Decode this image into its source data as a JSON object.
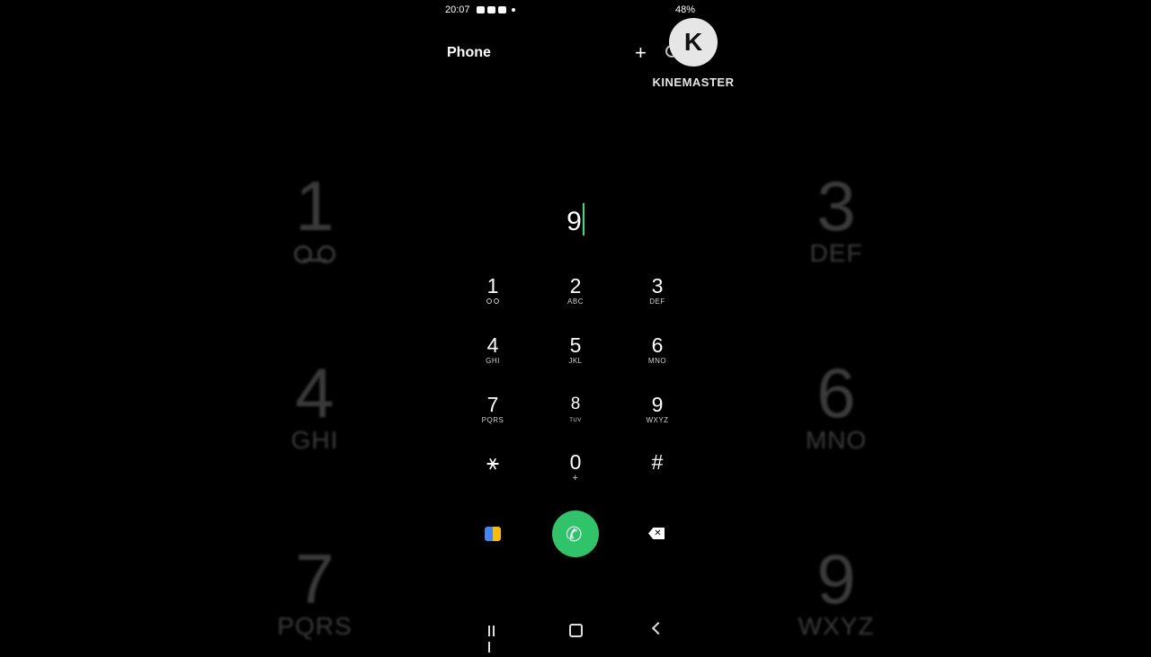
{
  "status": {
    "time": "20:07",
    "battery": "48%"
  },
  "header": {
    "title": "Phone",
    "add_icon": "plus-icon",
    "search_icon": "search-icon"
  },
  "watermark": {
    "letter": "K",
    "text": "KINEMASTER"
  },
  "dialer": {
    "entry": "9",
    "keys": [
      {
        "num": "1",
        "sub": ""
      },
      {
        "num": "2",
        "sub": "ABC"
      },
      {
        "num": "3",
        "sub": "DEF"
      },
      {
        "num": "4",
        "sub": "GHI"
      },
      {
        "num": "5",
        "sub": "JKL"
      },
      {
        "num": "6",
        "sub": "MNO"
      },
      {
        "num": "7",
        "sub": "PQRS"
      },
      {
        "num": "8",
        "sub": "TUV"
      },
      {
        "num": "9",
        "sub": "WXYZ"
      },
      {
        "num": "⚹",
        "sub": ""
      },
      {
        "num": "0",
        "sub": "+"
      },
      {
        "num": "#",
        "sub": ""
      }
    ]
  },
  "actions": {
    "call_color": "#2fc46a"
  },
  "background_keys": [
    {
      "num": "1",
      "sub": ""
    },
    {
      "num": "3",
      "sub": "DEF"
    },
    {
      "num": "4",
      "sub": "GHI"
    },
    {
      "num": "6",
      "sub": "MNO"
    },
    {
      "num": "7",
      "sub": "PQRS"
    },
    {
      "num": "9",
      "sub": "WXYZ"
    }
  ]
}
